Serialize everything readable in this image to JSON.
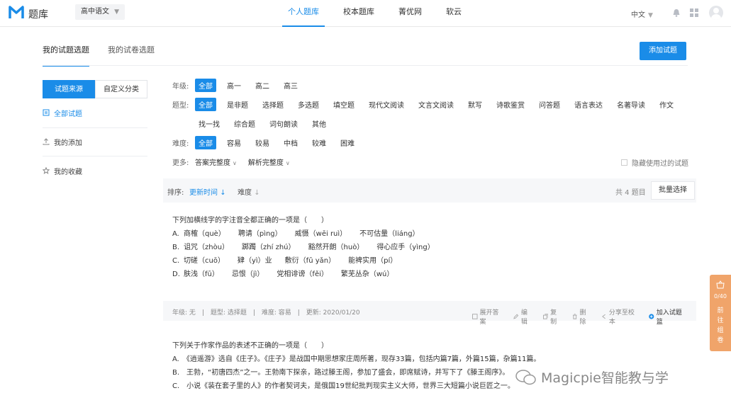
{
  "header": {
    "logo_text": "题库",
    "subject": "高中语文",
    "nav": [
      "个人题库",
      "校本题库",
      "菁优网",
      "软云"
    ],
    "lang": "中文",
    "accent": "#1a8ce8"
  },
  "tabs": [
    "我的试题选题",
    "我的试卷选题"
  ],
  "add_button": "添加试题",
  "sidebar": {
    "source_buttons": [
      "试题来源",
      "自定义分类"
    ],
    "items": [
      "全部试题",
      "我的添加",
      "我的收藏"
    ]
  },
  "filters": {
    "grade": {
      "label": "年级:",
      "options": [
        "全部",
        "高一",
        "高二",
        "高三"
      ]
    },
    "type": {
      "label": "题型:",
      "options_row1": [
        "全部",
        "是非题",
        "选择题",
        "多选题",
        "填空题",
        "现代文阅读",
        "文言文阅读",
        "默写",
        "诗歌鉴赏",
        "问答题",
        "语言表达",
        "名著导读",
        "作文"
      ],
      "options_row2": [
        "找一找",
        "综合题",
        "词句朗读",
        "其他"
      ]
    },
    "difficulty": {
      "label": "难度:",
      "options": [
        "全部",
        "容易",
        "较易",
        "中档",
        "较难",
        "困难"
      ]
    },
    "more": {
      "label": "更多:",
      "options": [
        "答案完整度",
        "解析完整度"
      ]
    },
    "hide_used": "隐藏使用过的试题"
  },
  "sortbar": {
    "label": "排序:",
    "sort_time": "更新时间",
    "sort_diff": "难度",
    "count": "共 4 题目",
    "batch": "批量选择"
  },
  "question1": {
    "stem": "下列加横线字的字注音全都正确的一项是（　　）",
    "options": [
      {
        "letter": "A.",
        "items": [
          "商榷（què）",
          "聘请（pìng）",
          "威慑（wēi ruì）",
          "不可估量（liáng）"
        ]
      },
      {
        "letter": "B.",
        "items": [
          "诅咒（zhòu）",
          "踯躅（zhí zhú）",
          "豁然开朗（huò）",
          "得心应手（yìng）"
        ]
      },
      {
        "letter": "C.",
        "items": [
          "切磋（cuō）",
          "肄（yì）业",
          "敷衍（fū yǎn）",
          "能裨实用（pí）"
        ]
      },
      {
        "letter": "D.",
        "items": [
          "肤浅（fū）",
          "忌恨（jì）",
          "党相诽谤（fěi）",
          "繁芜丛杂（wú）"
        ]
      }
    ],
    "meta": "年级: 无　|　题型: 选择题　|　难度: 容易　|　更新: 2020/01/20",
    "actions": [
      "展开答案",
      "编辑",
      "复制",
      "删除",
      "分享至校本",
      "加入试题篮"
    ]
  },
  "question2": {
    "stem": "下列关于作家作品的表述不正确的一项是（　　）",
    "lines": [
      "A.　《逍遥游》选自《庄子》。《庄子》是战国中期思想家庄周所著，现存33篇，包括内篇7篇，外篇15篇，杂篇11篇。",
      "B.　王勃，“初唐四杰”之一。王勃南下探亲，路过滕王阁，参加了盛会，即席赋诗，并写下了《滕王阁序》。",
      "C.　小说《装在套子里的人》的作者契诃夫，是俄国19世纪批判现实主义大师，世界三大短篇小说巨匠之一。"
    ]
  },
  "cart": {
    "count": "0/40",
    "label": "前往组卷"
  },
  "watermark": "Magicpie智能教与学"
}
